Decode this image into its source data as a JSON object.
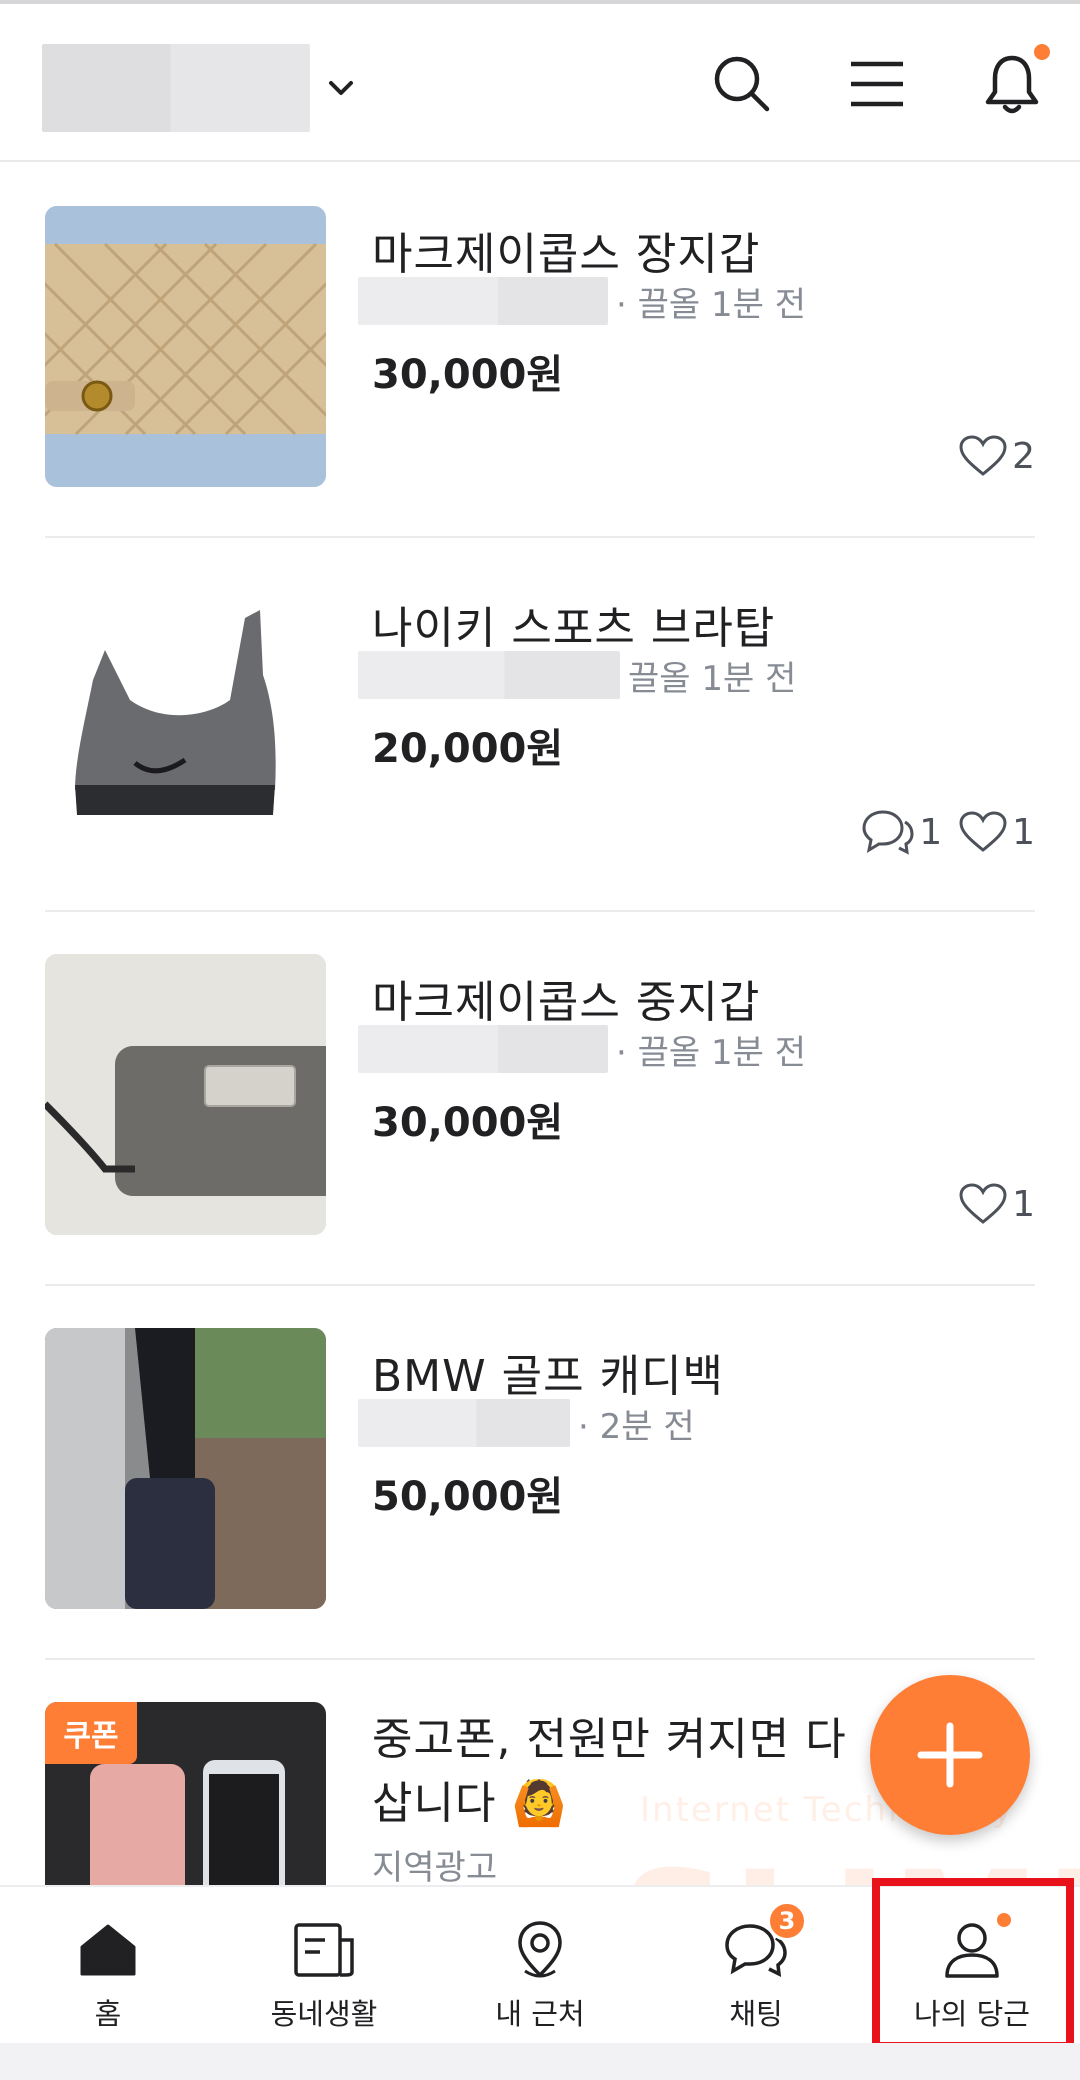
{
  "header": {
    "location_chevron_icon": "chevron-down-icon",
    "search_icon": "search-icon",
    "menu_icon": "hamburger-menu-icon",
    "notification_icon": "bell-icon"
  },
  "items": [
    {
      "title": "마크제이콥스 장지갑",
      "meta": "· 끌올 1분 전",
      "price": "30,000원",
      "likes": "2",
      "thumb": "beige-quilted-wallet"
    },
    {
      "title": "나이키 스포츠 브라탑",
      "meta": "끌올 1분 전",
      "price": "20,000원",
      "comments": "1",
      "likes": "1",
      "thumb": "grey-sports-bra"
    },
    {
      "title": "마크제이콥스 중지갑",
      "meta": "· 끌올 1분 전",
      "price": "30,000원",
      "likes": "1",
      "thumb": "grey-zip-wallet"
    },
    {
      "title": "BMW 골프 캐디백",
      "meta": "· 2분 전",
      "price": "50,000원",
      "thumb": "golf-caddie-bag"
    }
  ],
  "ad": {
    "badge": "쿠폰",
    "title_line1": "중고폰, 전원만 켜지면 다",
    "title_line2": "삽니다",
    "emoji": "🙆",
    "label": "지역광고"
  },
  "fab": {
    "icon": "plus-icon"
  },
  "watermark": {
    "line1": "Internet Technology",
    "line2": "SLIMI"
  },
  "bottom_nav": {
    "home": "홈",
    "community": "동네생활",
    "nearby": "내 근처",
    "chat": "채팅",
    "chat_badge": "3",
    "my": "나의 당근"
  },
  "colors": {
    "accent": "#ff7e36",
    "highlight": "#e8121b",
    "text": "#212124",
    "meta": "#868b94"
  }
}
